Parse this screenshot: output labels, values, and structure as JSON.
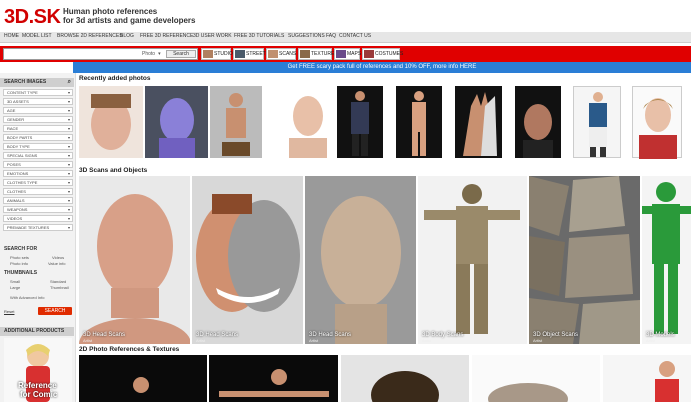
{
  "header": {
    "logo": "3D.SK",
    "tagline_line1": "Human photo references",
    "tagline_line2": "for 3d artists and game developers"
  },
  "nav": [
    "HOME",
    "MODEL LIST",
    "BROWSE 2D REFERENCES",
    "BLOG",
    "FREE 3D REFERENCE",
    "3D USER WORK",
    "FREE 3D TUTORIALS",
    "SUGGESTIONS",
    "FAQ",
    "CONTACT US"
  ],
  "search": {
    "select_value": "Photo",
    "button_label": "Search"
  },
  "categories": [
    {
      "label": "STUDIO",
      "color": "#b08060"
    },
    {
      "label": "STREET",
      "color": "#4a5a6a"
    },
    {
      "label": "SCANS",
      "color": "#c09070"
    },
    {
      "label": "TEXTURE",
      "color": "#8a6a4a"
    },
    {
      "label": "MAPS",
      "color": "#6a4a8a"
    },
    {
      "label": "COSTUMES",
      "color": "#9a3a3a"
    }
  ],
  "promo": "Get FREE scary pack full of references and 10% OFF, more info HERE",
  "sidebar": {
    "search_images": "SEARCH IMAGES",
    "filters": [
      "CONTENT TYPE",
      "3D ASSETS",
      "AGE",
      "GENDER",
      "RACE",
      "BODY PARTS",
      "BODY TYPE",
      "SPECIAL SIGNS",
      "POSES",
      "EMOTIONS",
      "CLOTHES TYPE",
      "CLOTHES",
      "ANIMALS",
      "WEAPONS",
      "VIDEOS",
      "PREMADE TEXTURES"
    ],
    "search_for": "SEARCH FOR",
    "search_for_options": [
      "Photo sets",
      "Videos",
      "Photo info",
      "Value info"
    ],
    "thumbnails": "THUMBNAILS",
    "thumb_options": [
      "Small",
      "Standard",
      "Large",
      "Thumbnail"
    ],
    "advanced": "With Advanced Info",
    "reset": "Reset",
    "search_btn": "SEARCH",
    "additional_products": "ADDITIONAL PRODUCTS",
    "product_text_1": "Reference",
    "product_text_2": "for Comic"
  },
  "sections": {
    "recent": "Recently added photos",
    "scans": "3D Scans and Objects",
    "refs": "2D Photo References & Textures"
  },
  "scans": [
    {
      "label": "3D Head Scans",
      "sub": "Artist"
    },
    {
      "label": "3D Head Scans",
      "sub": "Artist"
    },
    {
      "label": "3D Head Scans",
      "sub": "Artist"
    },
    {
      "label": "3D Body Scans",
      "sub": "Artist"
    },
    {
      "label": "3D Object Scans",
      "sub": "Artist"
    },
    {
      "label": "3D Models",
      "sub": "Artist"
    }
  ]
}
